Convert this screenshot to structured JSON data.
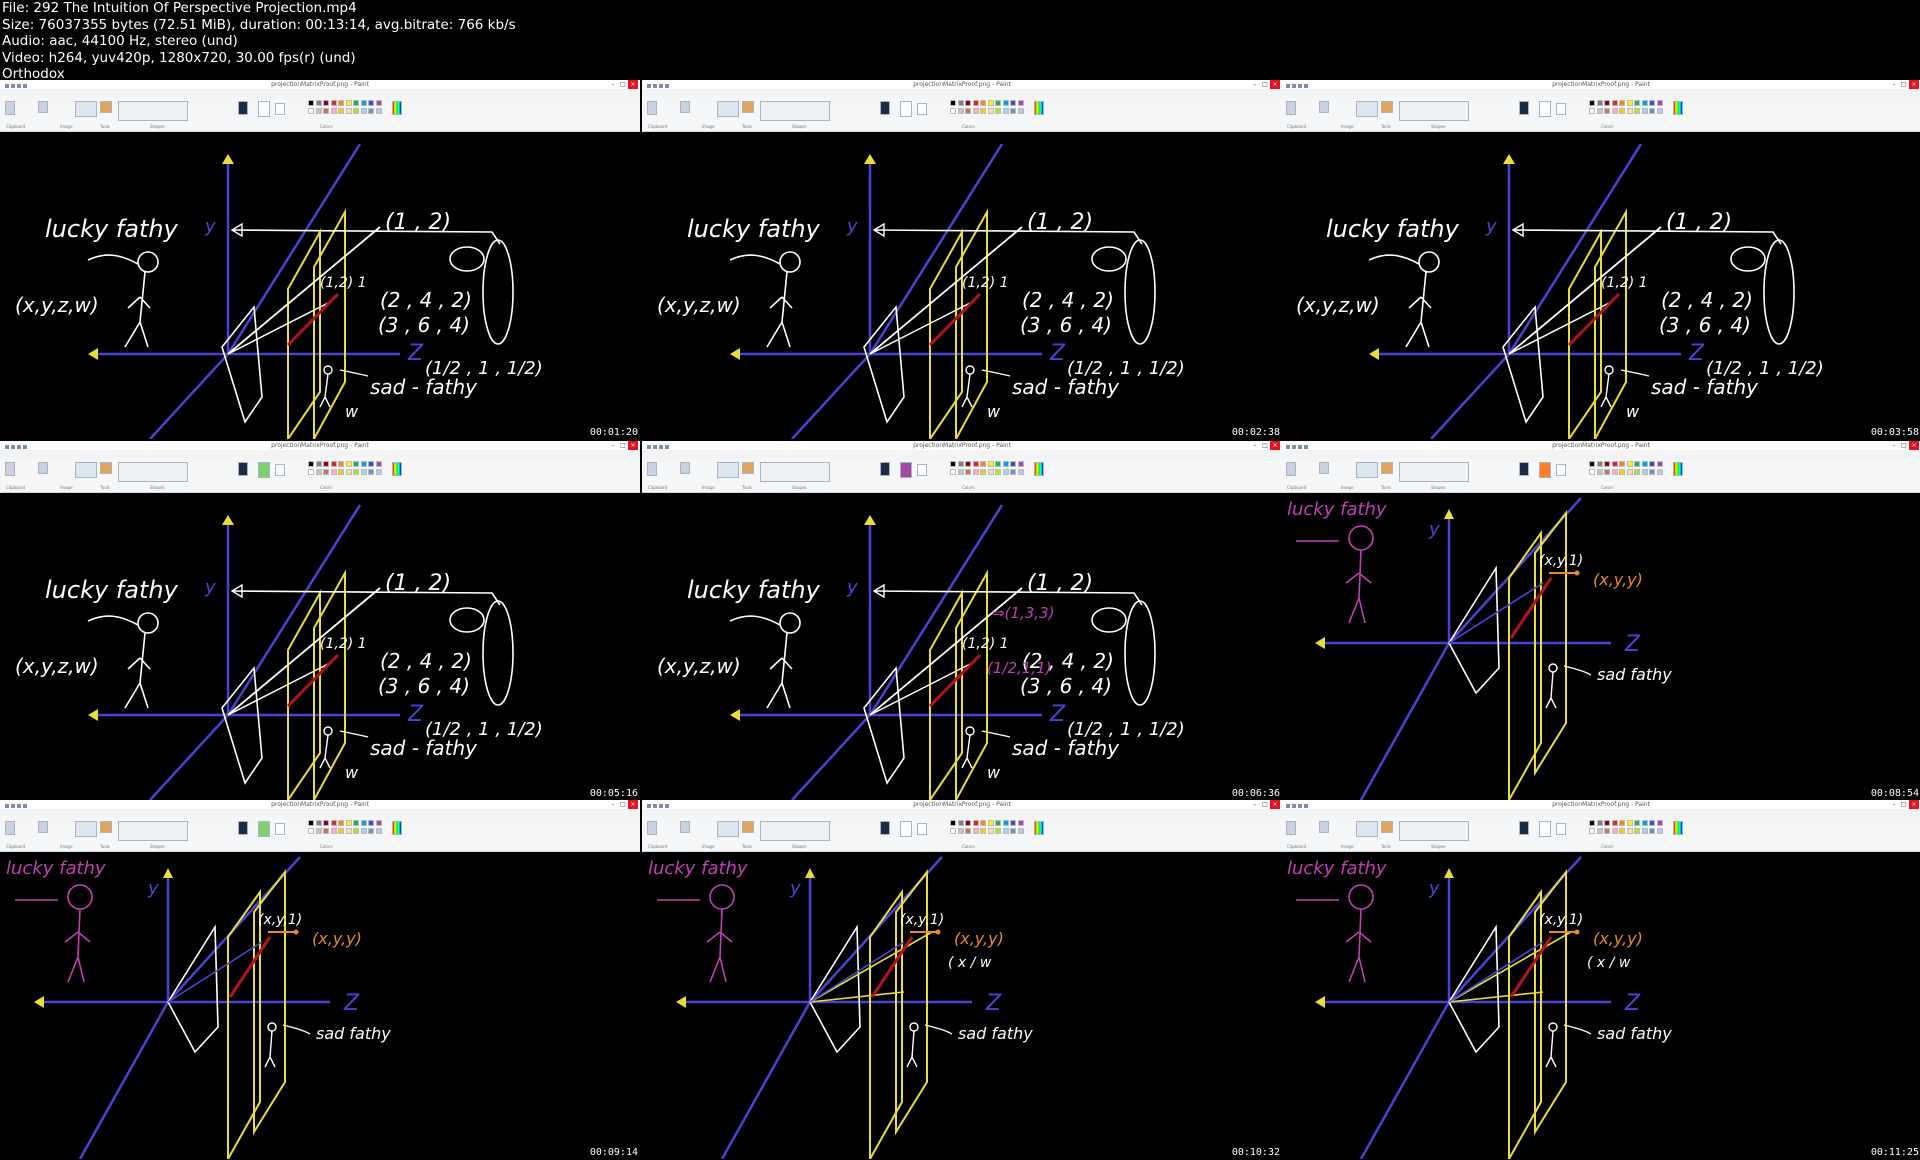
{
  "header": {
    "file": "File: 292 The Intuition Of Perspective Projection.mp4",
    "size": "Size: 76037355 bytes (72.51 MiB), duration: 00:13:14, avg.bitrate: 766 kb/s",
    "audio": "Audio: aac, 44100 Hz, stereo (und)",
    "video": "Video: h264, yuv420p, 1280x720, 30.00 fps(r) (und)",
    "extra": "Orthodox"
  },
  "window": {
    "title": "projectionMatrixProof.png - Paint",
    "menu": [
      "File",
      "Home",
      "View"
    ],
    "groups": [
      "Clipboard",
      "Image",
      "Tools",
      "Shapes",
      "Colors"
    ],
    "buttons": [
      "Paste",
      "Select",
      "Brushes",
      "Size",
      "Color 1",
      "Color 2",
      "Edit colors"
    ]
  },
  "colors": {
    "chalk": "#ffffff",
    "axis": "#4a44d6",
    "plane": "#e8dd3a",
    "ray": "#b4121e",
    "arrow": "#e8dd3a",
    "pink": "#c23fb3",
    "orange": "#e98a2b",
    "palette": [
      "#000000",
      "#7f7f7f",
      "#880015",
      "#ed1c24",
      "#ff7f27",
      "#fff200",
      "#22b14c",
      "#00a2e8",
      "#3f48cc",
      "#a349a4",
      "#ffffff",
      "#c3c3c3",
      "#b97a57",
      "#ffaec9",
      "#ffc90e",
      "#efe4b0",
      "#b5e61d",
      "#99d9ea",
      "#7092be",
      "#c8bfe7"
    ]
  },
  "sceneA": {
    "lucky": "lucky fathy",
    "coord_y": "y",
    "coord_z": "Z",
    "coord_w": "w",
    "homog": "(x,y,z,w)",
    "p12": "(1 , 2)",
    "p121": "(1,2) 1",
    "p242": "(2 , 4 , 2)",
    "p364": "(3 , 6 , 4)",
    "phalf": "(1/2 , 1 , 1/2)",
    "sad": "sad - fathy",
    "extra1": "⇒(1,3,3)",
    "extra2": "(1/2,1,1)"
  },
  "sceneB": {
    "lucky": "lucky fathy",
    "coord_y": "y",
    "coord_z": "Z",
    "xy1": "(x,y,1)",
    "xyy": "(x,y,y)",
    "xw": "( x / w",
    "sad": "sad fathy"
  },
  "frames": [
    {
      "time": "00:01:20",
      "scene": "A",
      "color1": "#ffffff"
    },
    {
      "time": "00:02:38",
      "scene": "A",
      "color1": "#ffffff"
    },
    {
      "time": "00:03:58",
      "scene": "A",
      "color1": "#ffffff"
    },
    {
      "time": "00:05:16",
      "scene": "A",
      "color1": "#7fd06e"
    },
    {
      "time": "00:06:36",
      "scene": "A2",
      "color1": "#a349a4"
    },
    {
      "time": "00:08:54",
      "scene": "B",
      "color1": "#ff7f27"
    },
    {
      "time": "00:09:14",
      "scene": "B",
      "color1": "#7fd06e"
    },
    {
      "time": "00:10:32",
      "scene": "B2",
      "color1": "#ffffff"
    },
    {
      "time": "00:11:25",
      "scene": "B2",
      "color1": "#ffffff"
    }
  ]
}
